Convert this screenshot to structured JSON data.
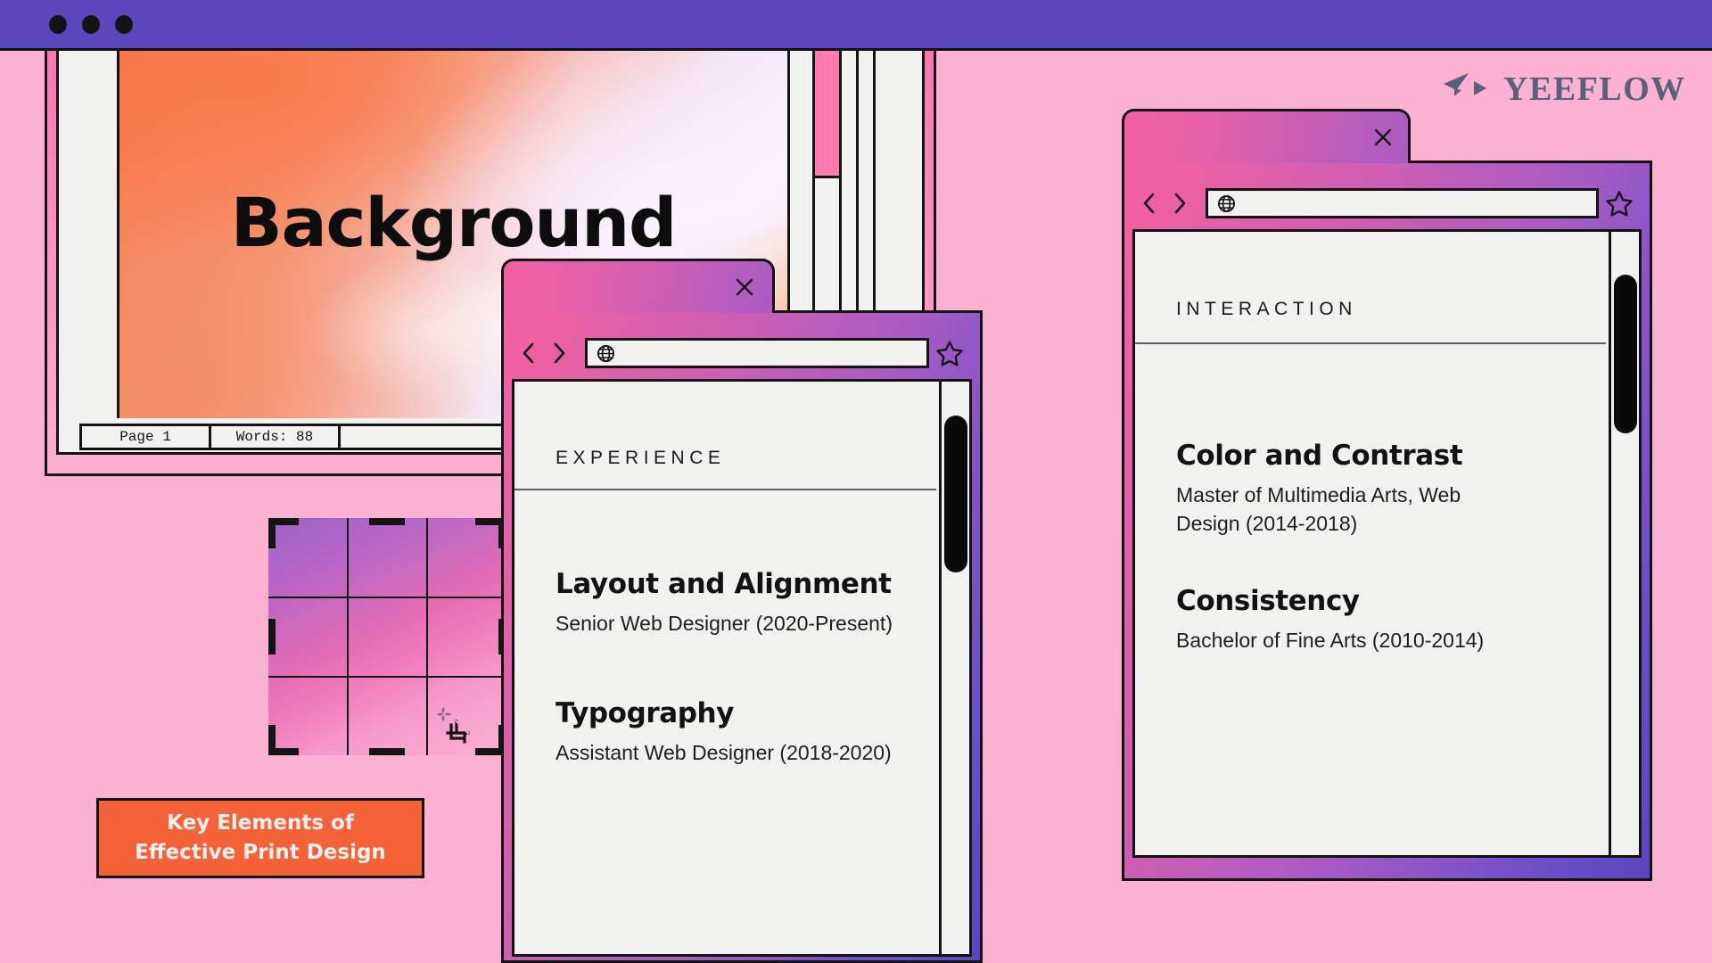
{
  "app": {
    "background_color": "#FBB1D0",
    "titlebar_color": "#5B46BE",
    "accent_orange": "#F4623A",
    "logo_color": "#5A6077"
  },
  "titlebar": {
    "dot_1": "window-dot-red",
    "dot_2": "window-dot-yellow",
    "dot_3": "window-dot-green"
  },
  "logo": {
    "wordmark": "YEEFLOW",
    "icon": "paper-plane-icon"
  },
  "document_window": {
    "page_title": "Background",
    "statusbar": {
      "page": "Page 1",
      "words": "Words: 88",
      "extra": ""
    },
    "scrollbar": "document-scrollbar"
  },
  "crop_tool": {
    "name": "rule-of-thirds-crop-grid",
    "cursor_icon": "crop-cursor-icon",
    "gradient_from": "#9A63C4",
    "gradient_to": "#FBB1D0"
  },
  "key_button": {
    "label": "Key Elements of Effective Print Design",
    "background": "#F4623A"
  },
  "browsers": [
    {
      "id": "experience",
      "close_label": "×",
      "back_icon": "chevron-left-icon",
      "forward_icon": "chevron-right-icon",
      "globe_icon": "globe-icon",
      "star_icon": "star-icon",
      "address_value": "",
      "address_placeholder": "",
      "section_kicker": "EXPERIENCE",
      "entries": [
        {
          "title": "Layout and Alignment",
          "subtitle": "Senior Web Designer (2020-Present)"
        },
        {
          "title": "Typography",
          "subtitle": "Assistant Web Designer (2018-2020)"
        }
      ]
    },
    {
      "id": "interaction",
      "close_label": "×",
      "back_icon": "chevron-left-icon",
      "forward_icon": "chevron-right-icon",
      "globe_icon": "globe-icon",
      "star_icon": "star-icon",
      "address_value": "",
      "address_placeholder": "",
      "section_kicker": "INTERACTION",
      "entries": [
        {
          "title": "Color and Contrast",
          "subtitle": "Master of Multimedia Arts, Web Design (2014-2018)"
        },
        {
          "title": "Consistency",
          "subtitle": "Bachelor of Fine Arts (2010-2014)"
        }
      ]
    }
  ]
}
